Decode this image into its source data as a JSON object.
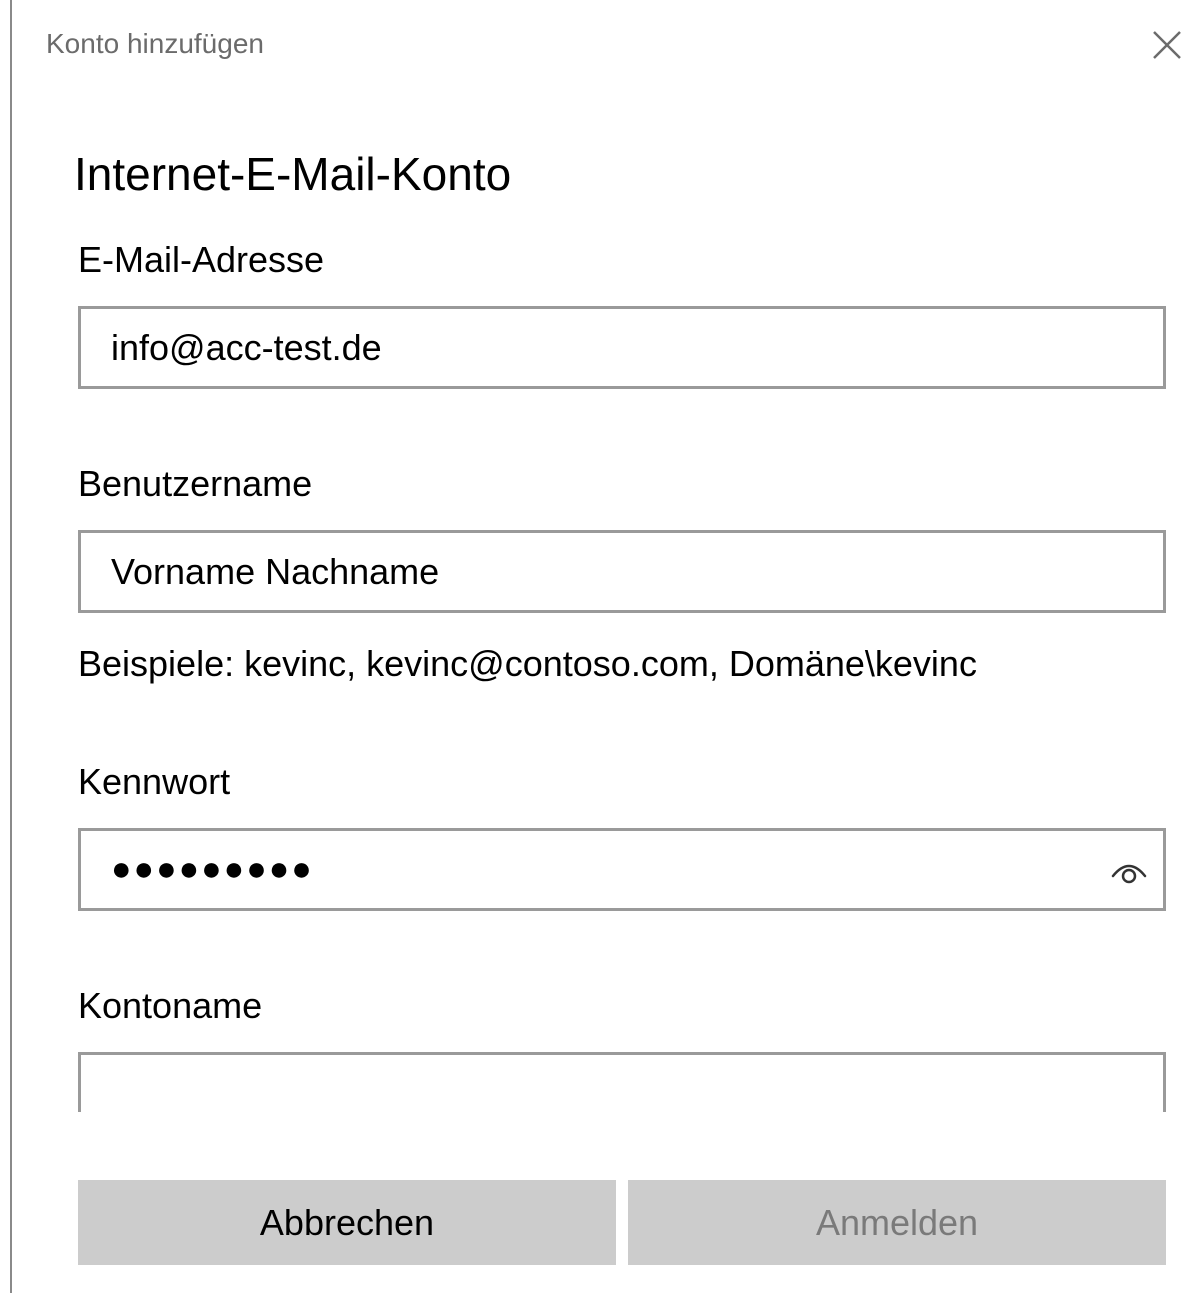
{
  "window": {
    "title": "Konto hinzufügen",
    "close_icon": "close-icon"
  },
  "form": {
    "heading": "Internet-E-Mail-Konto",
    "email": {
      "label": "E-Mail-Adresse",
      "value": "info@acc-test.de"
    },
    "username": {
      "label": "Benutzername",
      "value": "Vorname Nachname",
      "hint": "Beispiele: kevinc, kevinc@contoso.com, Domäne\\kevinc"
    },
    "password": {
      "label": "Kennwort",
      "masked_value": "●●●●●●●●●",
      "reveal_icon": "eye-icon"
    },
    "account_name": {
      "label": "Kontoname",
      "value": ""
    }
  },
  "buttons": {
    "cancel_label": "Abbrechen",
    "signin_label": "Anmelden"
  },
  "colors": {
    "field_border": "#9a9a9a",
    "button_bg": "#cccccc",
    "disabled_text": "#7a7a7a",
    "title_text": "#6b6b6b"
  }
}
